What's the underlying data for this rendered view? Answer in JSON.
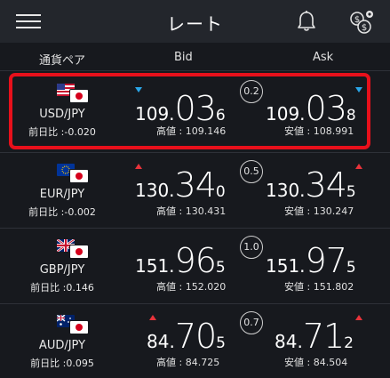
{
  "header": {
    "title": "レート"
  },
  "columns": {
    "pair": "通貨ペア",
    "bid": "Bid",
    "ask": "Ask"
  },
  "colors": {
    "up": "#e8333b",
    "down": "#2aa6e8",
    "highlight": "#e8101b"
  },
  "rows": [
    {
      "pair": "USD/JPY",
      "change": "前日比 :-0.020",
      "base_flag": "us-flag-icon",
      "bid_dir": "down",
      "ask_dir": "down",
      "bid": {
        "p1": "109.",
        "p2": "03",
        "p3": "6"
      },
      "spread": "0.2",
      "ask": {
        "p1": "109.",
        "p2": "03",
        "p3": "8"
      },
      "high": "高値 : 109.146",
      "low": "安値 : 108.991"
    },
    {
      "pair": "EUR/JPY",
      "change": "前日比 :-0.002",
      "base_flag": "eu-flag-icon",
      "bid_dir": "up",
      "ask_dir": "up",
      "bid": {
        "p1": "130.",
        "p2": "34",
        "p3": "0"
      },
      "spread": "0.5",
      "ask": {
        "p1": "130.",
        "p2": "34",
        "p3": "5"
      },
      "high": "高値 : 130.431",
      "low": "安値 : 130.247"
    },
    {
      "pair": "GBP/JPY",
      "change": "前日比 :0.146",
      "base_flag": "uk-flag-icon",
      "bid_dir": "none",
      "ask_dir": "none",
      "bid": {
        "p1": "151.",
        "p2": "96",
        "p3": "5"
      },
      "spread": "1.0",
      "ask": {
        "p1": "151.",
        "p2": "97",
        "p3": "5"
      },
      "high": "高値 : 152.020",
      "low": "安値 : 151.802"
    },
    {
      "pair": "AUD/JPY",
      "change": "前日比 :0.095",
      "base_flag": "au-flag-icon",
      "bid_dir": "up",
      "ask_dir": "up",
      "bid": {
        "p1": "84.",
        "p2": "70",
        "p3": "5"
      },
      "spread": "0.7",
      "ask": {
        "p1": "84.",
        "p2": "71",
        "p3": "2"
      },
      "high": "高値 : 84.725",
      "low": "安値 : 84.504"
    }
  ]
}
